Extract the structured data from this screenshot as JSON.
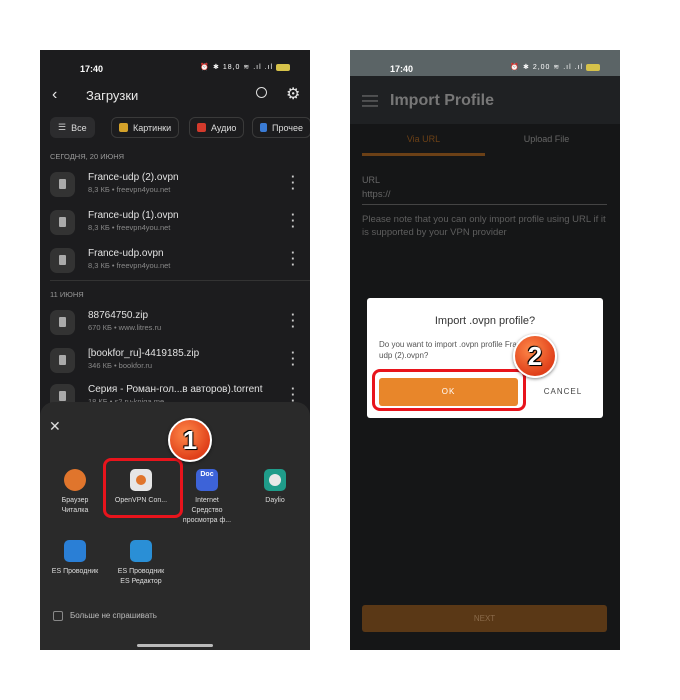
{
  "left_phone": {
    "status": {
      "time": "17:40",
      "icons": "⏰ ✱ 18,0 ≋ .ıl .ıl"
    },
    "header": {
      "title": "Загрузки",
      "back_icon": "arrow-left",
      "search_icon": "search",
      "settings_icon": "gear"
    },
    "chips": [
      {
        "label": "Все",
        "icon": "list"
      },
      {
        "label": "Картинки",
        "icon": "image",
        "color": "#d4a22a"
      },
      {
        "label": "Аудио",
        "icon": "music",
        "color": "#d33a2c"
      },
      {
        "label": "Прочее",
        "icon": "file",
        "color": "#3a7bd5"
      }
    ],
    "sections": [
      {
        "title": "СЕГОДНЯ, 20 ИЮНЯ",
        "files": [
          {
            "name": "France-udp (2).ovpn",
            "meta": "8,3 КБ • freevpn4you.net"
          },
          {
            "name": "France-udp (1).ovpn",
            "meta": "8,3 КБ • freevpn4you.net"
          },
          {
            "name": "France-udp.ovpn",
            "meta": "8,3 КБ • freevpn4you.net"
          }
        ]
      },
      {
        "title": "11 ИЮНЯ",
        "files": [
          {
            "name": "88764750.zip",
            "meta": "670 КБ • www.litres.ru"
          },
          {
            "name": "[bookfor_ru]-4419185.zip",
            "meta": "346 КБ • bookfor.ru"
          },
          {
            "name": "Серия - Роман-гол...в авторов).torrent",
            "meta": "18 КБ • s2.ru-kniga.me"
          }
        ]
      }
    ],
    "share_sheet": {
      "apps": [
        {
          "label": "Браузер\nЧиталка",
          "color": "#e0752c"
        },
        {
          "label": "OpenVPN Con...",
          "color": "#e6e6e6"
        },
        {
          "label": "Internet\nСредство\nпросмотра ф...",
          "color": "#3d63d8"
        },
        {
          "label": "Daylio",
          "color": "#1f9c8a"
        },
        {
          "label": "ES Проводник",
          "color": "#2a7fd6"
        },
        {
          "label": "ES Проводник\nES Редактор",
          "color": "#2a8fd6"
        }
      ],
      "checkbox_label": "Больше не спрашивать",
      "checked": false
    },
    "step_badge": "1"
  },
  "right_phone": {
    "status": {
      "time": "17:40",
      "icons": "⏰ ✱ 2,00 ≋ .ıl .ıl"
    },
    "header": {
      "title": "Import Profile"
    },
    "tabs": [
      {
        "label": "Via URL",
        "active": true
      },
      {
        "label": "Upload File",
        "active": false
      }
    ],
    "url_label": "URL",
    "url_value": "https://",
    "note": "Please note that you can only import profile using URL if it is supported by your VPN provider",
    "dialog": {
      "title": "Import .ovpn profile?",
      "message": "Do you want to import .ovpn profile France-udp (2).ovpn?",
      "ok": "OK",
      "cancel": "CANCEL"
    },
    "next_button": "NEXT",
    "accent": "#e8862a",
    "step_badge": "2"
  }
}
